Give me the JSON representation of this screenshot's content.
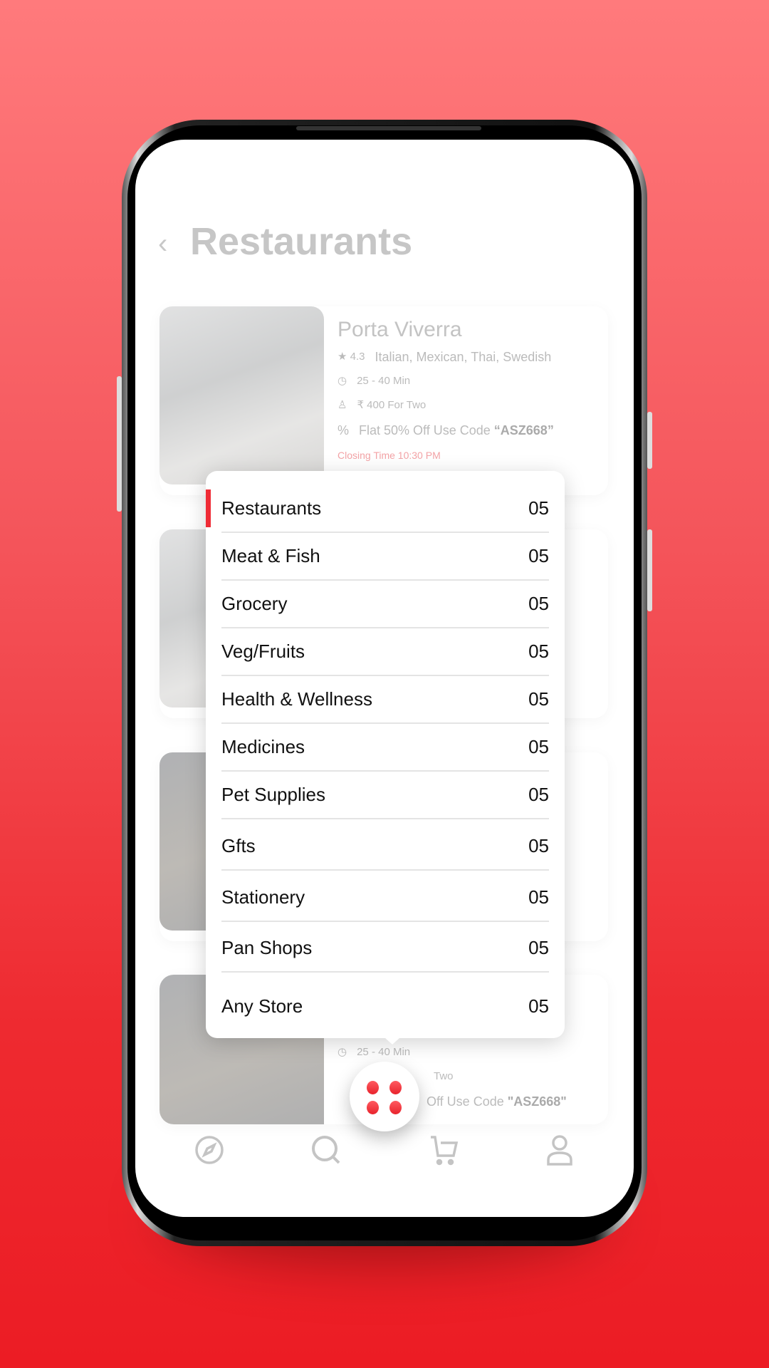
{
  "header": {
    "title": "Restaurants",
    "back_icon": "chevron-left-icon"
  },
  "cards": [
    {
      "name": "Porta Viverra",
      "rating": "4.3",
      "cuisines": "Italian, Mexican, Thai, Swedish",
      "time": "25 - 40 Min",
      "price": "₹ 400 For Two",
      "offer_prefix": "Flat 50% Off Use Code ",
      "offer_code": "“ASZ668”",
      "closing": "Closing Time 10:30 PM"
    },
    {
      "time": "25 - 40 Min",
      "price": "Two",
      "offer_prefix": "Off Use Code ",
      "offer_code": "\"ASZ668\""
    }
  ],
  "menu": {
    "items": [
      {
        "label": "Restaurants",
        "count": "05",
        "active": true
      },
      {
        "label": "Meat & Fish",
        "count": "05"
      },
      {
        "label": "Grocery",
        "count": "05"
      },
      {
        "label": "Veg/Fruits",
        "count": "05"
      },
      {
        "label": "Health & Wellness",
        "count": "05"
      },
      {
        "label": "Medicines",
        "count": "05"
      },
      {
        "label": "Pet Supplies",
        "count": "05"
      },
      {
        "label": "Gfts",
        "count": "05"
      },
      {
        "label": "Stationery",
        "count": "05"
      },
      {
        "label": "Pan Shops",
        "count": "05"
      },
      {
        "label": "Any Store",
        "count": "05"
      }
    ]
  },
  "nav": {
    "items": [
      "compass-icon",
      "search-icon",
      "cart-icon",
      "profile-icon"
    ],
    "fab_icon": "grid-dots-icon"
  },
  "colors": {
    "accent": "#ef2b35",
    "background_top": "#ff7a7c",
    "background_bottom": "#ec1c24"
  }
}
